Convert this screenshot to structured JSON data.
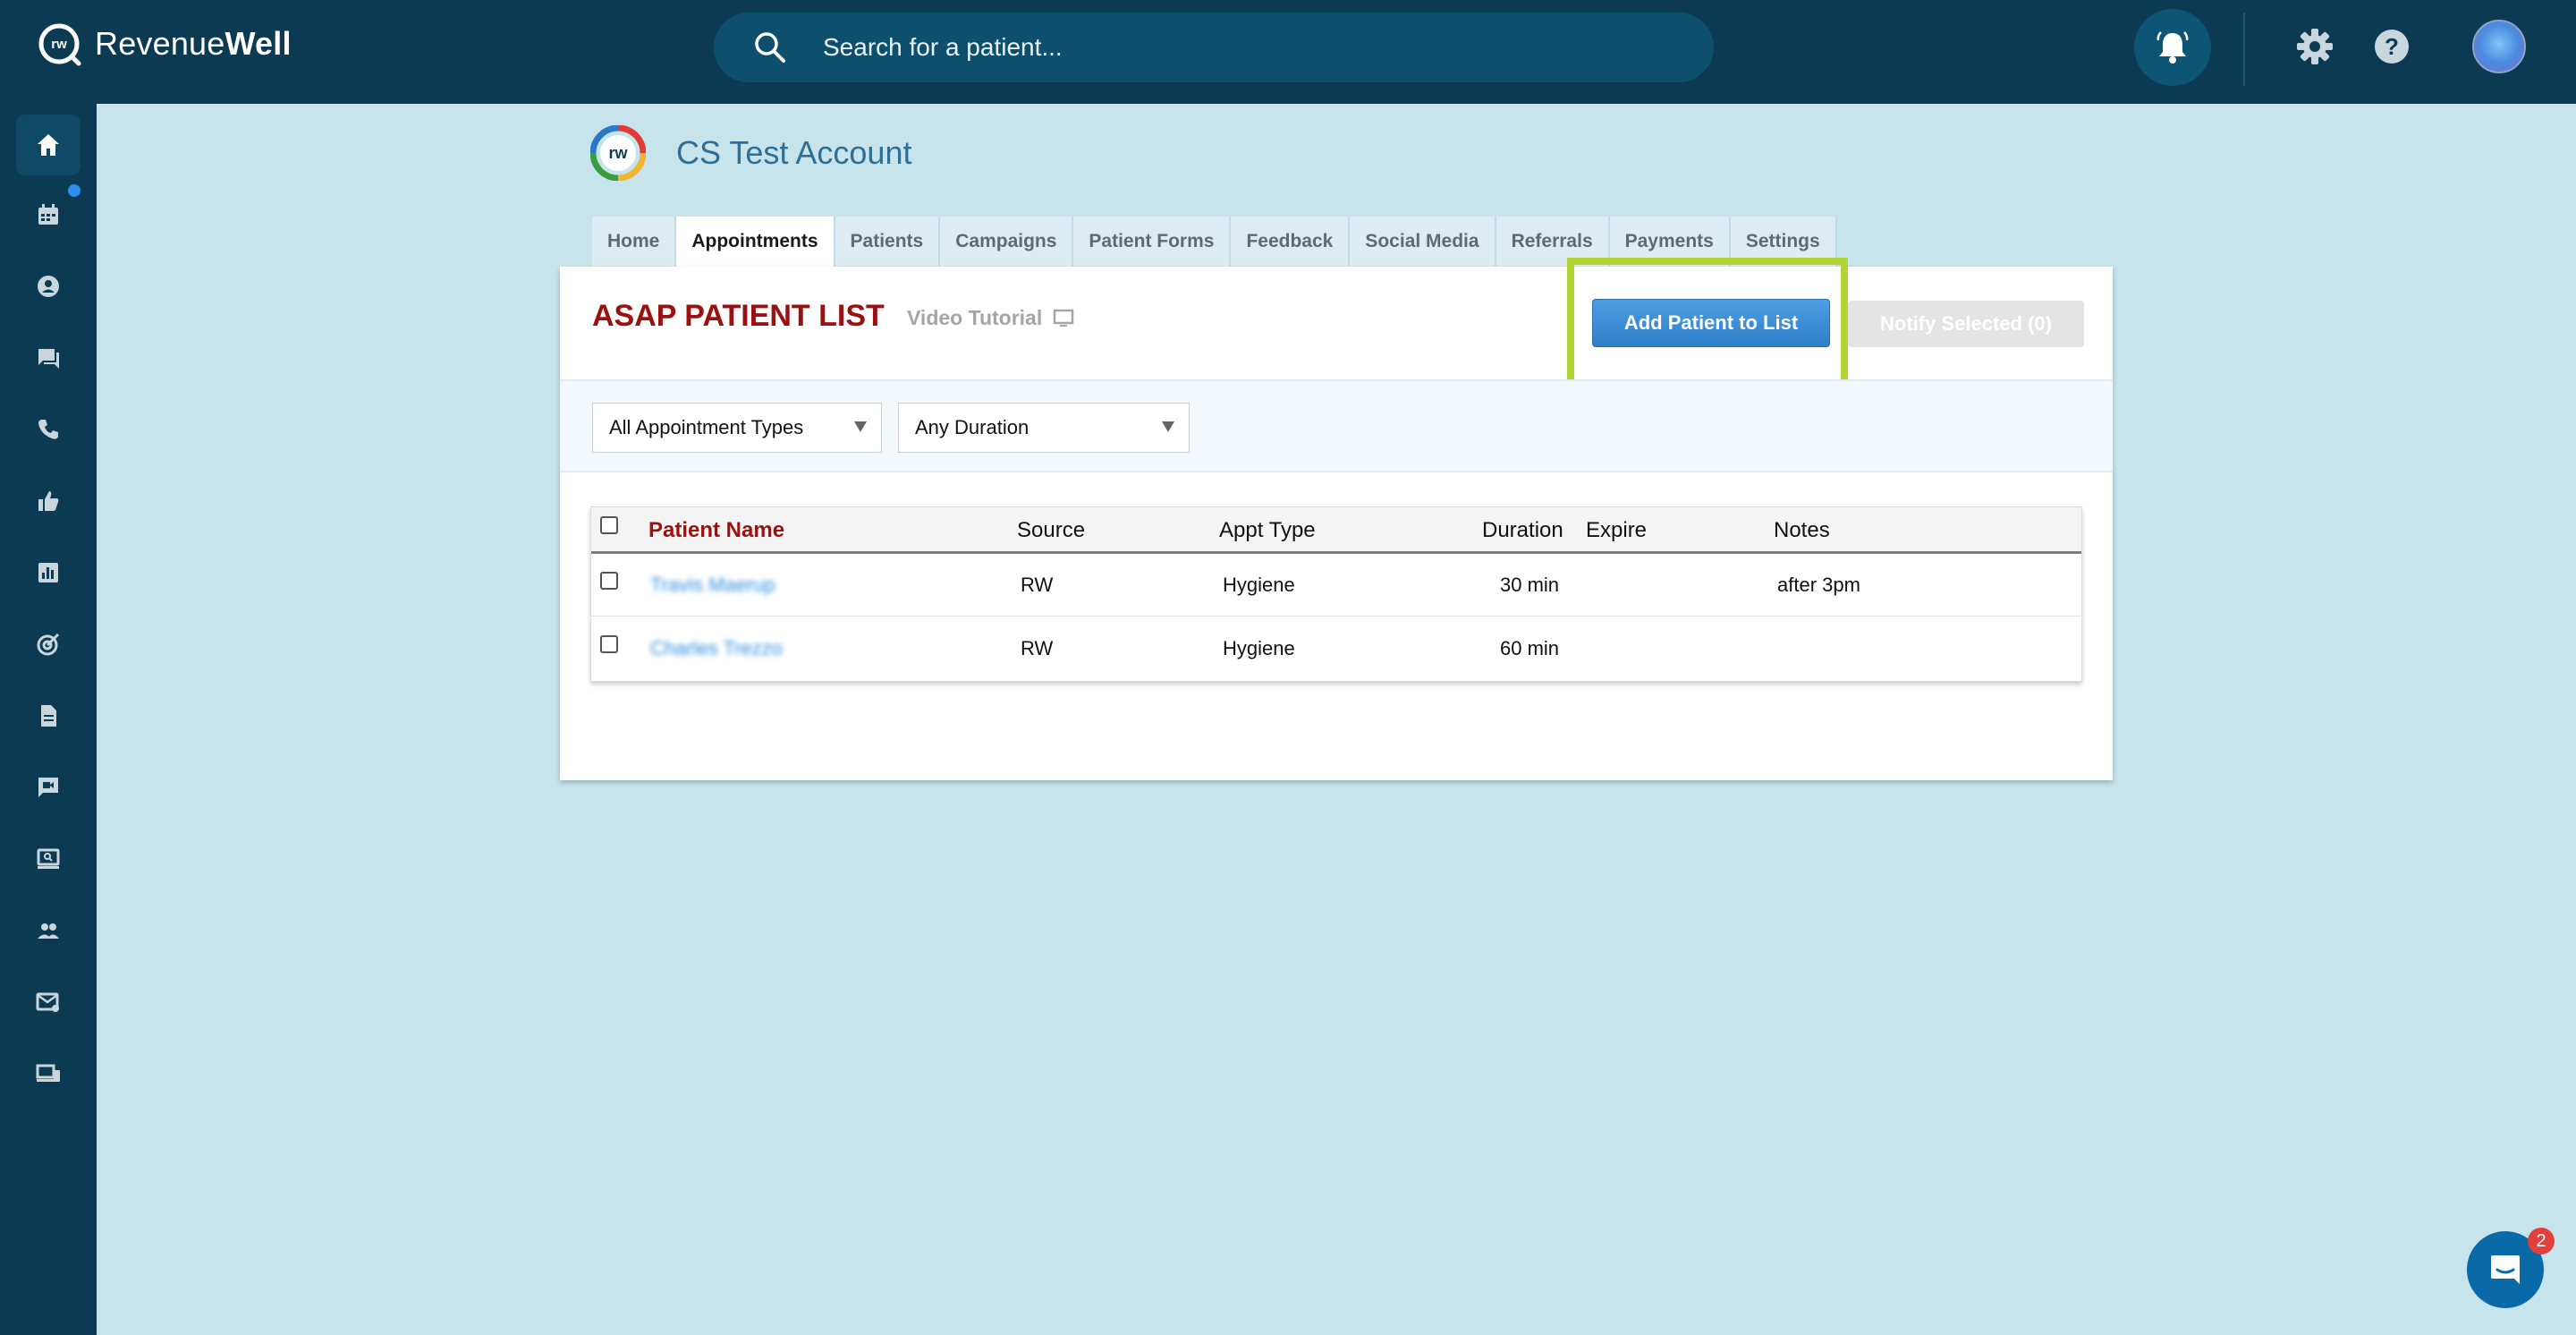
{
  "brand": {
    "name_light": "Revenue",
    "name_bold": "Well"
  },
  "search": {
    "placeholder": "Search for a patient..."
  },
  "account": {
    "name": "CS Test Account"
  },
  "tabs": [
    {
      "label": "Home"
    },
    {
      "label": "Appointments"
    },
    {
      "label": "Patients"
    },
    {
      "label": "Campaigns"
    },
    {
      "label": "Patient Forms"
    },
    {
      "label": "Feedback"
    },
    {
      "label": "Social Media"
    },
    {
      "label": "Referrals"
    },
    {
      "label": "Payments"
    },
    {
      "label": "Settings"
    }
  ],
  "active_tab": "Appointments",
  "panel": {
    "title": "ASAP PATIENT LIST",
    "video_tutorial": "Video Tutorial",
    "add_button": "Add Patient to List",
    "notify_button": "Notify Selected (0)"
  },
  "filters": {
    "appointment_type": "All Appointment Types",
    "duration": "Any Duration"
  },
  "table": {
    "headers": {
      "name": "Patient Name",
      "source": "Source",
      "appt_type": "Appt Type",
      "duration": "Duration",
      "expire": "Expire",
      "notes": "Notes"
    },
    "rows": [
      {
        "name": "Travis Maerup",
        "source": "RW",
        "appt_type": "Hygiene",
        "duration": "30 min",
        "expire": "",
        "notes": "after 3pm"
      },
      {
        "name": "Charles Trezzo",
        "source": "RW",
        "appt_type": "Hygiene",
        "duration": "60 min",
        "expire": "",
        "notes": ""
      }
    ]
  },
  "chat": {
    "badge": "2"
  },
  "colors": {
    "topbar": "#0b3a52",
    "background": "#c7e4ec",
    "title_red": "#9b1010",
    "button_blue": "#3a8bd5",
    "highlight_green": "#b3d435"
  }
}
